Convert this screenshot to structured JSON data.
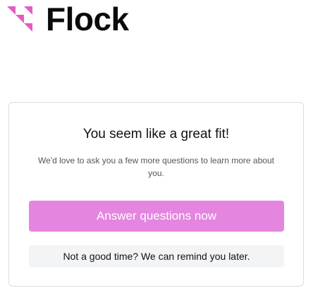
{
  "brand": {
    "name": "Flock",
    "logo_icon": "flock-triangles-logo",
    "logo_color": "#e45bc4"
  },
  "card": {
    "title": "You seem like a great fit!",
    "description": "We'd love to ask you a few more questions to learn more about you.",
    "primary_button_label": "Answer questions now",
    "secondary_button_label": "Not a good time? We can remind you later."
  },
  "colors": {
    "primary_button_bg": "#e485e0",
    "primary_button_text": "#ffffff",
    "secondary_button_bg": "#f3f4f6",
    "card_border": "#dcdcdc"
  }
}
